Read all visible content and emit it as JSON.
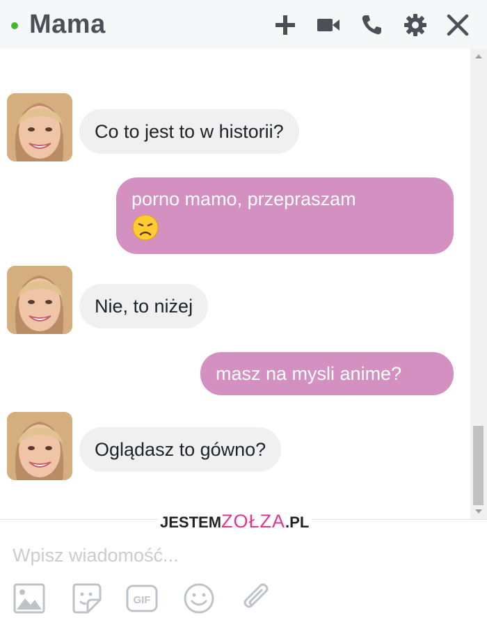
{
  "header": {
    "title": "Mama",
    "status_color": "#42b72a",
    "icons": [
      "plus-icon",
      "video-camera-icon",
      "phone-icon",
      "gear-icon",
      "close-icon"
    ]
  },
  "messages": [
    {
      "direction": "incoming",
      "text": "Co to jest to w historii?"
    },
    {
      "direction": "outgoing",
      "text": "porno mamo, przepraszam",
      "emoji": "😞"
    },
    {
      "direction": "incoming",
      "text": "Nie, to niżej"
    },
    {
      "direction": "outgoing",
      "text": "masz na mysli anime?"
    },
    {
      "direction": "incoming",
      "text": "Oglądasz to gówno?"
    }
  ],
  "watermark": {
    "left": "JESTEM",
    "middle": "ZOŁZA",
    "right": ".PL"
  },
  "composer": {
    "placeholder": "Wpisz wiadomość...",
    "tools": [
      "image-icon",
      "sticker-icon",
      "gif-icon",
      "emoji-icon",
      "attachment-icon"
    ],
    "gif_label": "GIF"
  },
  "colors": {
    "outgoing_bubble": "#d590c2",
    "incoming_bubble": "#f1f0f0",
    "header_bg": "#f6f7f9"
  }
}
